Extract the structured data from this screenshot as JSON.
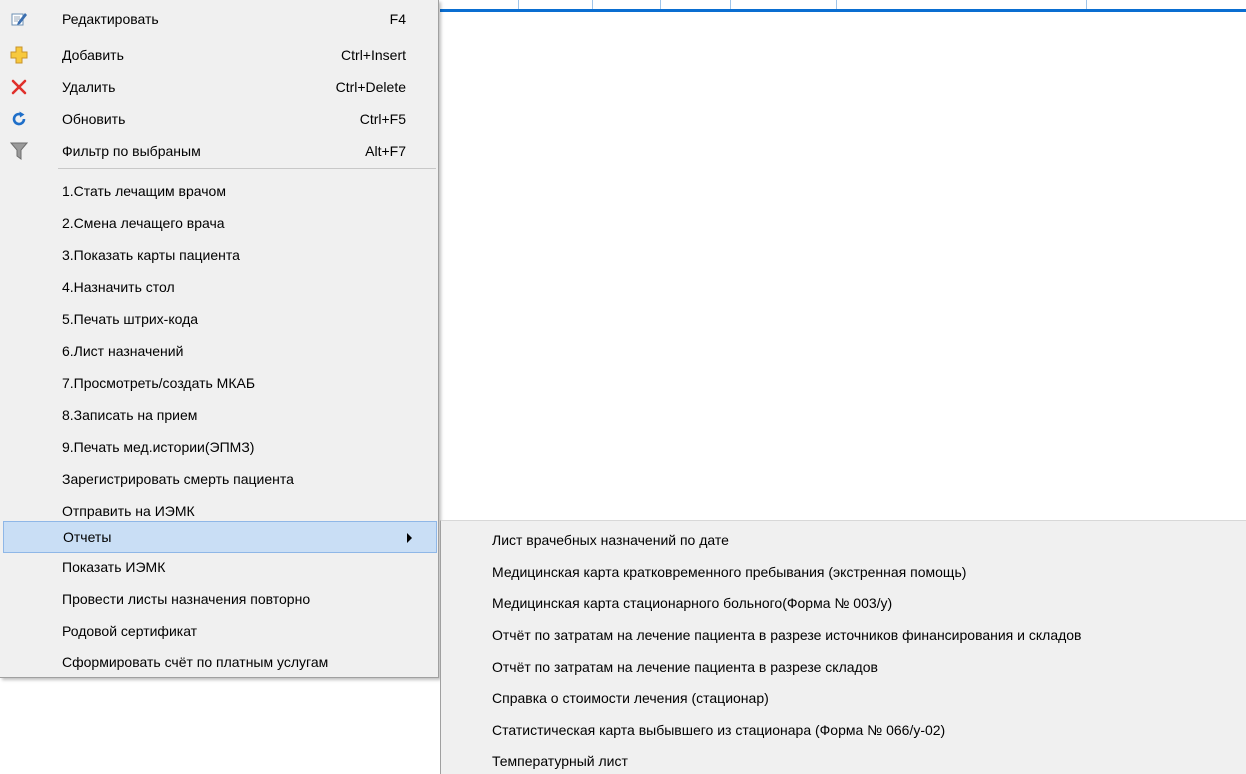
{
  "menu": {
    "items": [
      {
        "label": "Редактировать",
        "shortcut": "F4",
        "icon": "edit-icon"
      },
      {
        "label": "Добавить",
        "shortcut": "Ctrl+Insert",
        "icon": "add-icon"
      },
      {
        "label": "Удалить",
        "shortcut": "Ctrl+Delete",
        "icon": "delete-icon"
      },
      {
        "label": "Обновить",
        "shortcut": "Ctrl+F5",
        "icon": "refresh-icon"
      },
      {
        "label": "Фильтр по выбраным",
        "shortcut": "Alt+F7",
        "icon": "filter-icon"
      },
      {
        "label": "1.Стать лечащим врачом"
      },
      {
        "label": "2.Смена лечащего врача"
      },
      {
        "label": "3.Показать карты пациента"
      },
      {
        "label": "4.Назначить стол"
      },
      {
        "label": "5.Печать штрих-кода"
      },
      {
        "label": "6.Лист назначений"
      },
      {
        "label": "7.Просмотреть/создать МКАБ"
      },
      {
        "label": "8.Записать на прием"
      },
      {
        "label": "9.Печать мед.истории(ЭПМЗ)"
      },
      {
        "label": "Зарегистрировать смерть пациента"
      },
      {
        "label": "Отправить на ИЭМК"
      },
      {
        "label": "Отчеты"
      },
      {
        "label": "Показать ИЭМК"
      },
      {
        "label": "Провести листы назначения повторно"
      },
      {
        "label": "Родовой сертификат"
      },
      {
        "label": "Сформировать счёт по платным услугам"
      }
    ]
  },
  "submenu": {
    "items": [
      {
        "label": "Лист врачебных назначений по дате"
      },
      {
        "label": "Медицинская карта кратковременного пребывания (экстренная помощь)"
      },
      {
        "label": "Медицинская карта стационарного больного(Форма № 003/у)"
      },
      {
        "label": "Отчёт по затратам на лечение пациента в разрезе источников финансирования и складов"
      },
      {
        "label": "Отчёт по затратам на лечение пациента в разрезе складов"
      },
      {
        "label": "Справка о стоимости лечения (стационар)"
      },
      {
        "label": "Статистическая карта выбывшего из стационара (Форма № 066/у-02)"
      },
      {
        "label": "Температурный лист"
      }
    ]
  },
  "colors": {
    "menu_bg": "#f0f0f0",
    "highlight_bg": "#c9def5",
    "highlight_border": "#8fb7e7",
    "grid_header_blue": "#0a6ed1"
  }
}
